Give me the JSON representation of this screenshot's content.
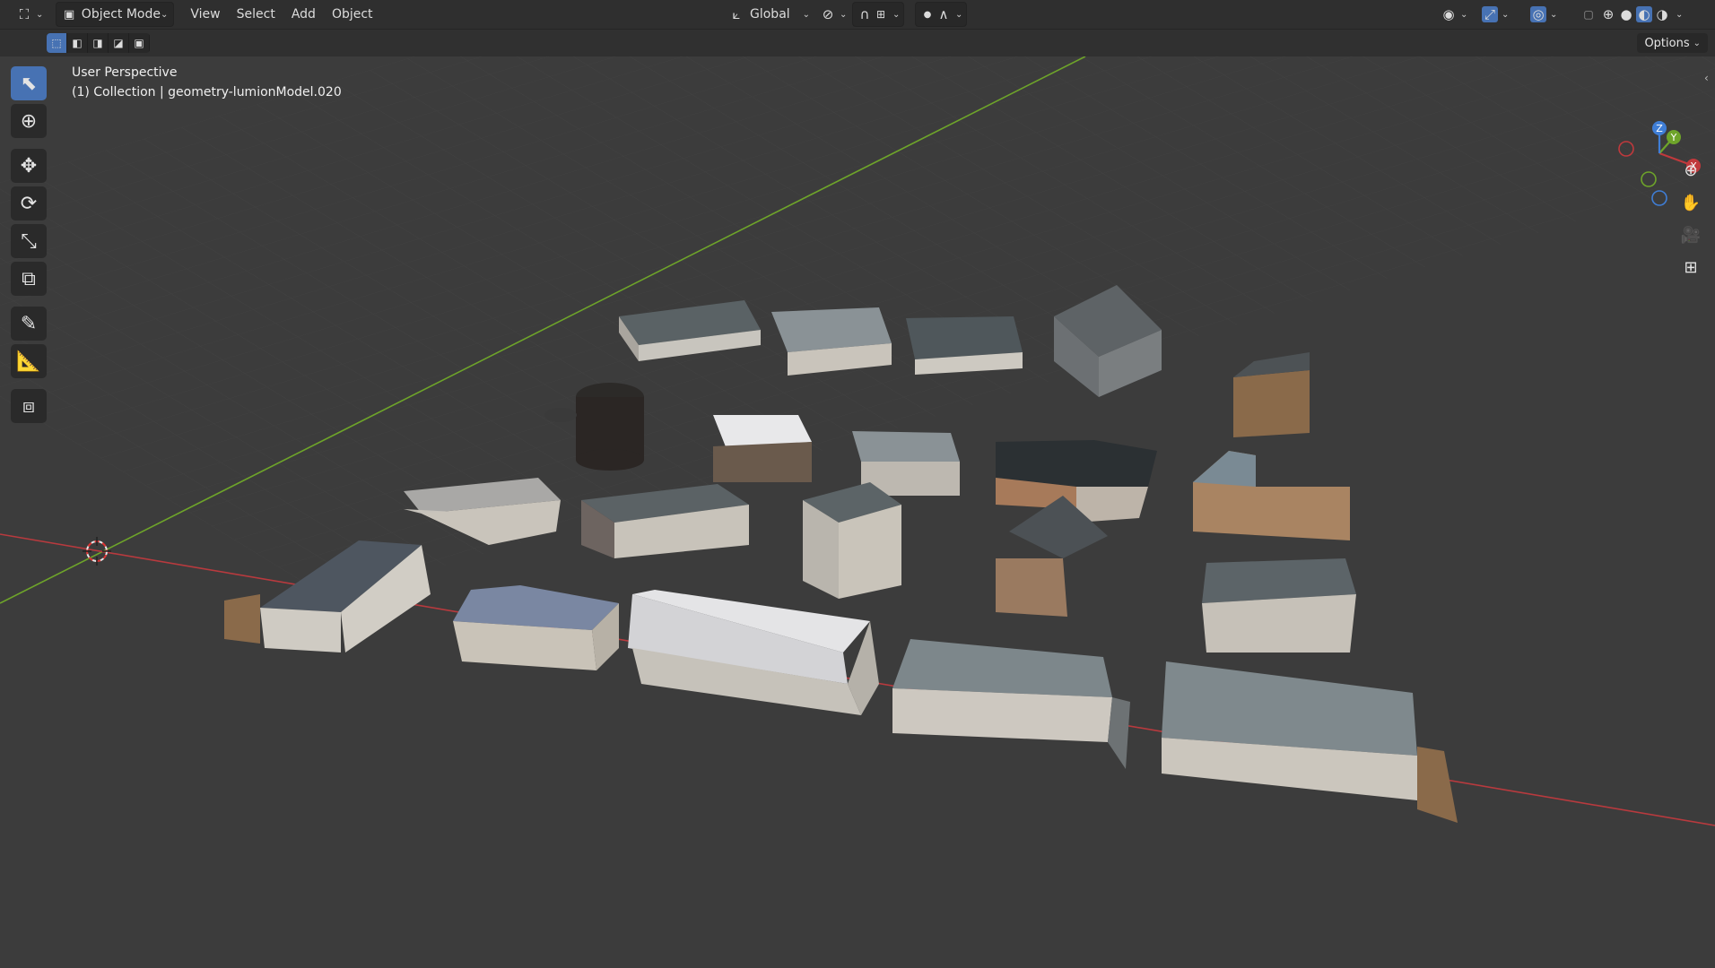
{
  "header": {
    "editor_icon": "viewport-editor-icon",
    "mode_label": "Object Mode",
    "menu": [
      "View",
      "Select",
      "Add",
      "Object"
    ],
    "orientation_label": "Global"
  },
  "subbar": {
    "options_label": "Options"
  },
  "viewport": {
    "view_name": "User Perspective",
    "collection_info": "(1) Collection | geometry-lumionModel.020",
    "gizmo_axes": {
      "x": "X",
      "y": "Y",
      "z": "Z"
    }
  },
  "toolbar": {
    "tools": [
      "select-box",
      "cursor",
      "move",
      "rotate",
      "scale",
      "transform",
      "annotate",
      "measure",
      "add-cube"
    ],
    "active_tool": "select-box"
  },
  "navigation": [
    "zoom-icon",
    "pan-hand-icon",
    "camera-icon",
    "perspective-grid-icon"
  ],
  "colors": {
    "accent": "#4772b3",
    "x_axis": "#c0393c",
    "y_axis": "#6ea42a",
    "z_axis": "#3f7ed6",
    "grid": "#474747",
    "viewport_bg": "#3c3c3c"
  }
}
